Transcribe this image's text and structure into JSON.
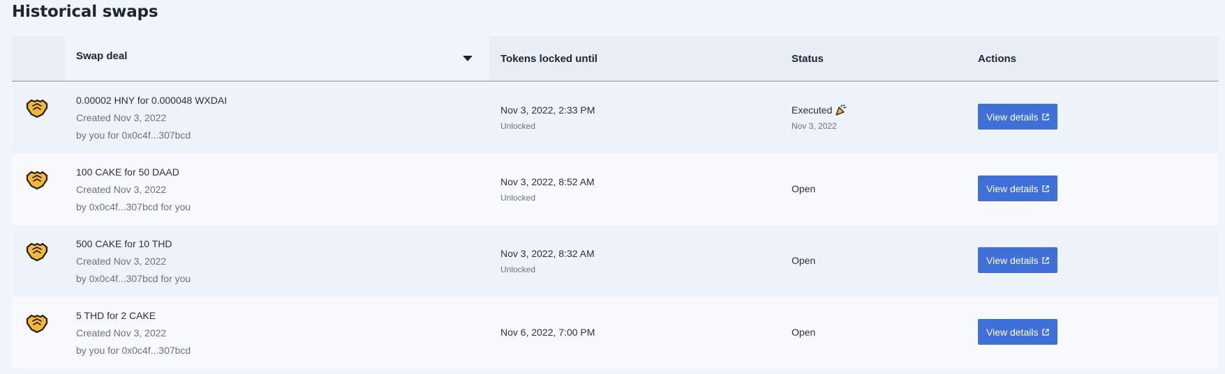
{
  "page": {
    "title": "Historical swaps"
  },
  "table": {
    "headers": {
      "deal": "Swap deal",
      "locked": "Tokens locked until",
      "status": "Status",
      "actions": "Actions"
    },
    "rows": [
      {
        "deal": "0.00002 HNY for 0.000048 WXDAI",
        "created": "Created Nov 3, 2022",
        "parties": "by you for 0x0c4f...307bcd",
        "locked_until": "Nov 3, 2022, 2:33 PM",
        "lock_state": "Unlocked",
        "status": "Executed",
        "status_date": "Nov 3, 2022",
        "action_label": "View details"
      },
      {
        "deal": "100 CAKE for 50 DAAD",
        "created": "Created Nov 3, 2022",
        "parties": "by 0x0c4f...307bcd for you",
        "locked_until": "Nov 3, 2022, 8:52 AM",
        "lock_state": "Unlocked",
        "status": "Open",
        "action_label": "View details"
      },
      {
        "deal": "500 CAKE for 10 THD",
        "created": "Created Nov 3, 2022",
        "parties": "by 0x0c4f...307bcd for you",
        "locked_until": "Nov 3, 2022, 8:32 AM",
        "lock_state": "Unlocked",
        "status": "Open",
        "action_label": "View details"
      },
      {
        "deal": "5 THD for 2 CAKE",
        "created": "Created Nov 3, 2022",
        "parties": "by you for 0x0c4f...307bcd",
        "locked_until": "Nov 6, 2022, 7:00 PM",
        "status": "Open",
        "action_label": "View details"
      }
    ]
  },
  "icons": {
    "row_icon": "handshake-icon",
    "executed_icon": "party-popper-icon",
    "button_icon": "external-link-icon",
    "sort_icon": "sort-down-icon"
  },
  "colors": {
    "button": "#3f6fd8",
    "handshake": "#f5b82e"
  }
}
